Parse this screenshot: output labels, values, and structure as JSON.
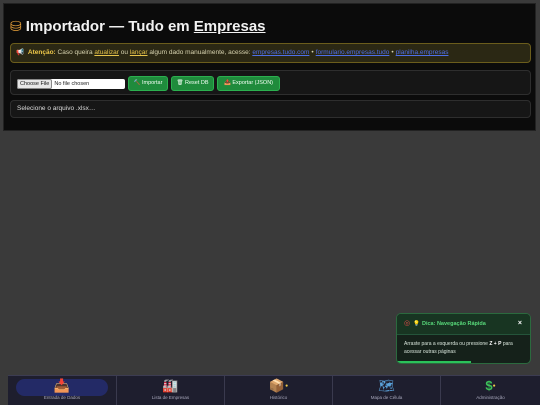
{
  "header": {
    "title_prefix": "Importador — Tudo em ",
    "title_link": "Empresas"
  },
  "warning": {
    "strong": "Atenção:",
    "text_1": " Caso queira ",
    "link_update": "atualizar",
    "text_2": " ou ",
    "link_add": "lançar",
    "text_3": " algum dado manualmente, acesse: ",
    "external_links": [
      "empresas.tudo.com",
      "formulario.empresas.tudo",
      "planilha.empresas"
    ],
    "separator": "•"
  },
  "controls": {
    "choose_file_label": "Choose File",
    "no_file_text": "No file chosen",
    "import_label": "Importar",
    "reset_label": "Reset DB",
    "export_label": "Exportar (JSON)"
  },
  "status": {
    "message": "Selecione o arquivo .xlsx…"
  },
  "toast": {
    "title": "Dica: Navegação Rápida",
    "body_1": "Arraste para a esquerda ou pressione ",
    "shortcut": "Z + P",
    "body_2": " para acessar outras páginas",
    "close_label": "×"
  },
  "nav": {
    "items": [
      {
        "label": "Entrada de Dados",
        "icon": "inbox-tray-icon"
      },
      {
        "label": "Lista de Empresas",
        "icon": "factory-icon"
      },
      {
        "label": "Histórico",
        "icon": "package-icon"
      },
      {
        "label": "Mapa de Célula",
        "icon": "map-icon"
      },
      {
        "label": "Administração",
        "icon": "dollar-icon"
      }
    ]
  },
  "colors": {
    "accent_green": "#1f8b3c",
    "warning_yellow": "#f0c94a",
    "link_blue": "#4d6fe8",
    "nav_active": "#232a66"
  }
}
